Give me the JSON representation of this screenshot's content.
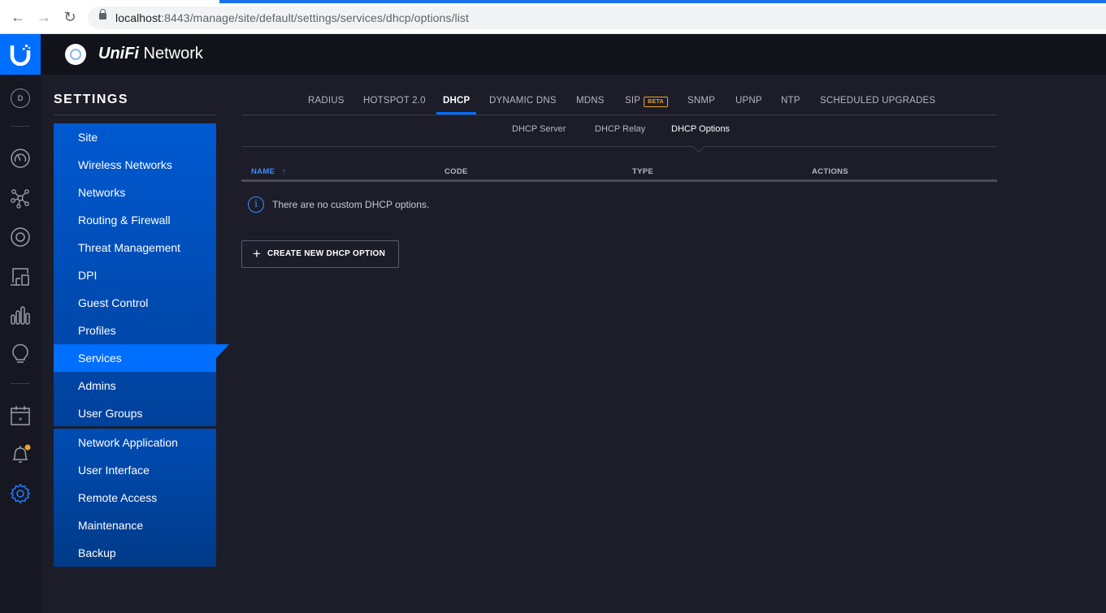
{
  "browser": {
    "url_host": "localhost",
    "url_rest": ":8443/manage/site/default/settings/services/dhcp/options/list"
  },
  "header": {
    "brand_italic": "UniFi",
    "brand_rest": " Network"
  },
  "rail": {
    "avatar_letter": "D",
    "icons": [
      "dashboard-icon",
      "topology-icon",
      "devices-icon",
      "clients-icon",
      "statistics-icon",
      "insights-icon",
      "events-icon",
      "alerts-icon",
      "settings-icon"
    ],
    "alert_dot_color": "#f2a22a",
    "accent": "#006fff"
  },
  "settings": {
    "title": "SETTINGS",
    "menu_group1": [
      "Site",
      "Wireless Networks",
      "Networks",
      "Routing & Firewall",
      "Threat Management",
      "DPI",
      "Guest Control",
      "Profiles",
      "Services",
      "Admins",
      "User Groups"
    ],
    "menu_group2": [
      "Network Application",
      "User Interface",
      "Remote Access",
      "Maintenance",
      "Backup"
    ],
    "active_item": "Services"
  },
  "tabs": {
    "items": [
      "RADIUS",
      "HOTSPOT 2.0",
      "DHCP",
      "DYNAMIC DNS",
      "MDNS",
      "SIP",
      "SNMP",
      "UPNP",
      "NTP",
      "SCHEDULED UPGRADES"
    ],
    "active": "DHCP",
    "beta_label": "BETA"
  },
  "subtabs": {
    "items": [
      "DHCP Server",
      "DHCP Relay",
      "DHCP Options"
    ],
    "active": "DHCP Options"
  },
  "table": {
    "columns": [
      "NAME",
      "CODE",
      "TYPE",
      "ACTIONS"
    ],
    "sort_indicator": "↑",
    "empty_message": "There are no custom DHCP options."
  },
  "actions": {
    "create_label": "CREATE NEW DHCP OPTION"
  }
}
